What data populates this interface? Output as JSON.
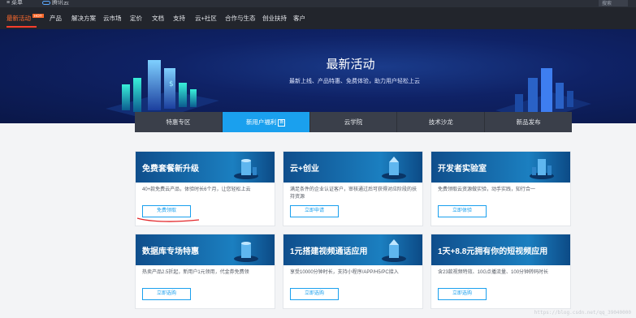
{
  "topbar": {
    "menu_label": "≡ 菜单",
    "logo_text": "腾讯云",
    "search_label": "搜索"
  },
  "nav": {
    "items": [
      {
        "label": "最新活动",
        "badge": "HOT",
        "active": true
      },
      {
        "label": "产品"
      },
      {
        "label": "解决方案"
      },
      {
        "label": "云市场"
      },
      {
        "label": "定价"
      },
      {
        "label": "文档"
      },
      {
        "label": "支持"
      },
      {
        "label": "云+社区"
      },
      {
        "label": "合作与生态"
      },
      {
        "label": "创业扶持"
      },
      {
        "label": "客户"
      }
    ]
  },
  "hero": {
    "title": "最新活动",
    "subtitle": "最新上线、产品特惠、免费体验，助力用户轻松上云"
  },
  "tabs": [
    {
      "label": "特惠专区"
    },
    {
      "label": "新用户福利",
      "tag": "新"
    },
    {
      "label": "云学院"
    },
    {
      "label": "技术沙龙"
    },
    {
      "label": "新品发布"
    }
  ],
  "cards": [
    {
      "title": "免费套餐新升级",
      "desc": "40+款免费云产品，体验时长6个月，让您轻松上云",
      "button": "免费领取"
    },
    {
      "title": "云+创业",
      "desc": "满足条件的企业认证客户，审核通过后可获得对应阶段的扶持资源",
      "button": "立即申请"
    },
    {
      "title": "开发者实验室",
      "desc": "免费领取云资源做实验，动手实践，知行合一",
      "button": "立即体验"
    },
    {
      "title": "数据库专场特惠",
      "desc": "热卖产品2.5折起，新用户1元领用，代金券免费领",
      "button": "立即选购"
    },
    {
      "title": "1元搭建视频通话应用",
      "desc": "享受10000分钟时长，支持小程序/APP/H5/PC接入",
      "button": "立即选购"
    },
    {
      "title": "1天+8.8元拥有你的短视频应用",
      "desc": "含23款视频特效、10G点播流量、100分钟转码时长",
      "button": "立即选购"
    }
  ],
  "watermark": "https://blog.csdn.net/qq_39040000",
  "colors": {
    "accent": "#1aa0ee",
    "hot": "#ff6a2c",
    "nav_bg": "#22252c"
  }
}
